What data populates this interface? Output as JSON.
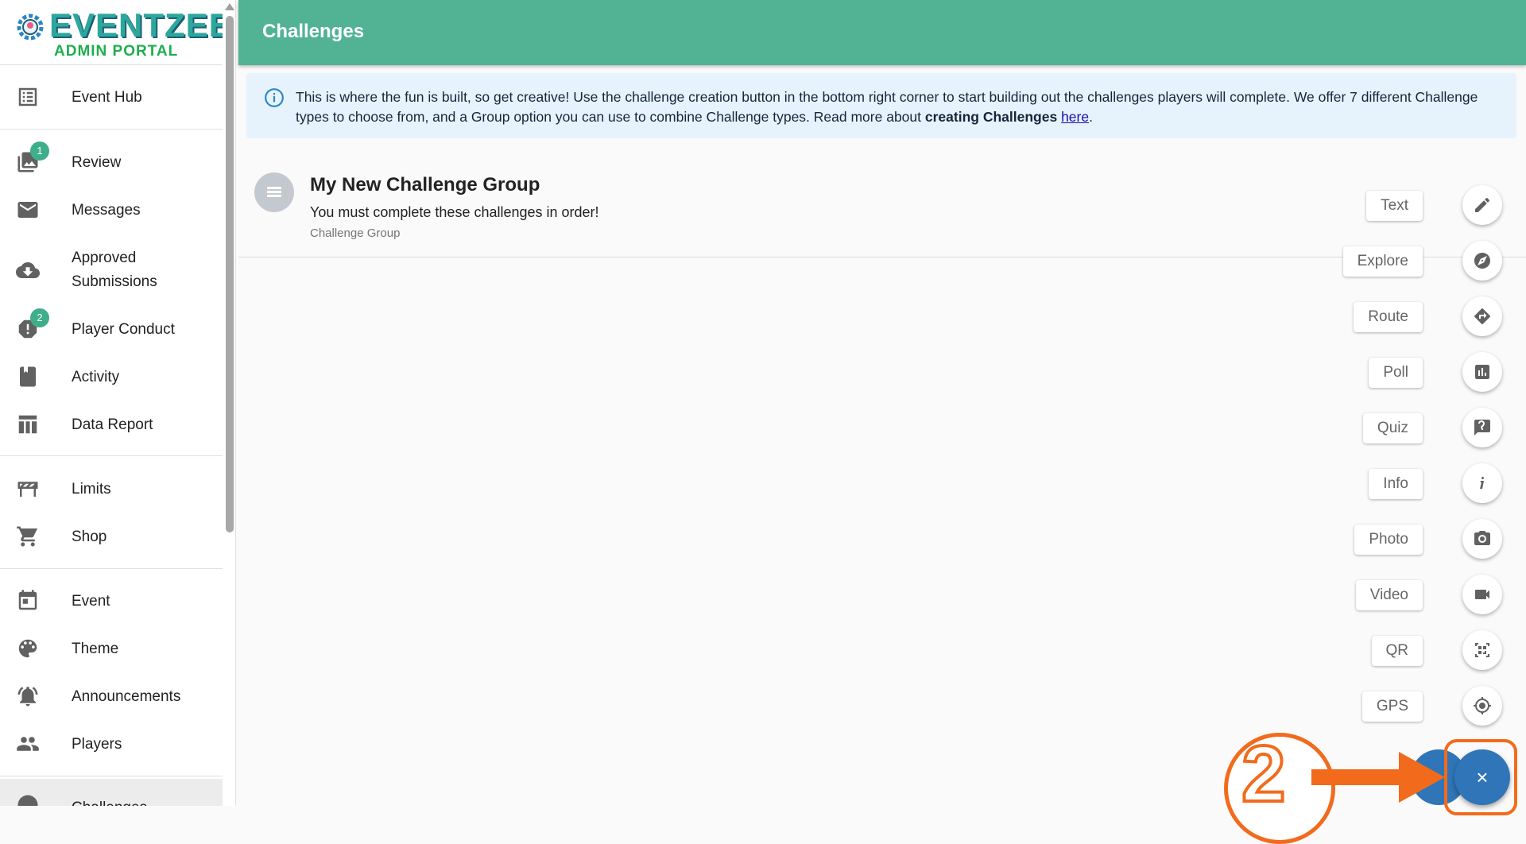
{
  "app": {
    "brand": "EVENTZEE",
    "subtitle": "ADMIN PORTAL"
  },
  "sidebar": {
    "items": [
      {
        "label": "Event Hub",
        "icon": "list-icon"
      },
      {
        "label": "Review",
        "icon": "photo-library-icon",
        "badge": "1"
      },
      {
        "label": "Messages",
        "icon": "mail-icon"
      },
      {
        "label": "Approved Submissions",
        "label_line1": "Approved",
        "label_line2": "Submissions",
        "icon": "cloud-download-icon"
      },
      {
        "label": "Player Conduct",
        "icon": "report-icon",
        "badge": "2"
      },
      {
        "label": "Activity",
        "icon": "book-icon"
      },
      {
        "label": "Data Report",
        "icon": "table-icon"
      },
      {
        "label": "Limits",
        "icon": "barrier-icon"
      },
      {
        "label": "Shop",
        "icon": "cart-icon"
      },
      {
        "label": "Event",
        "icon": "calendar-icon"
      },
      {
        "label": "Theme",
        "icon": "palette-icon"
      },
      {
        "label": "Announcements",
        "icon": "notification-bell-icon"
      },
      {
        "label": "Players",
        "icon": "people-icon"
      },
      {
        "label": "Challenges",
        "icon": "challenges-icon"
      }
    ]
  },
  "header": {
    "title": "Challenges"
  },
  "info": {
    "text_before": "This is where the fun is built, so get creative! Use the challenge creation button in the bottom right corner to start building out the challenges players will complete. We offer 7 different Challenge types to choose from, and a Group option you can use to combine Challenge types. Read more about ",
    "bold": "creating Challenges",
    "space": " ",
    "link": "here",
    "after": "."
  },
  "group": {
    "name": "My New Challenge Group",
    "description": "You must complete these challenges in order!",
    "type": "Challenge Group"
  },
  "speed_dial": [
    {
      "label": "Text",
      "icon": "pencil-icon"
    },
    {
      "label": "Explore",
      "icon": "compass-icon"
    },
    {
      "label": "Route",
      "icon": "directions-icon"
    },
    {
      "label": "Poll",
      "icon": "bar-chart-icon"
    },
    {
      "label": "Quiz",
      "icon": "question-bubble-icon"
    },
    {
      "label": "Info",
      "icon": "info-italic-icon"
    },
    {
      "label": "Photo",
      "icon": "camera-icon"
    },
    {
      "label": "Video",
      "icon": "video-camera-icon"
    },
    {
      "label": "QR",
      "icon": "qr-code-icon"
    },
    {
      "label": "GPS",
      "icon": "gps-target-icon"
    }
  ],
  "fab": {
    "label": "×"
  },
  "annotation": {
    "step": "2",
    "color": "#f26b1d"
  },
  "colors": {
    "header": "#52b394",
    "fab": "#2f75b7",
    "badge": "#3fae8a",
    "info_bg": "#e6f3fd"
  }
}
